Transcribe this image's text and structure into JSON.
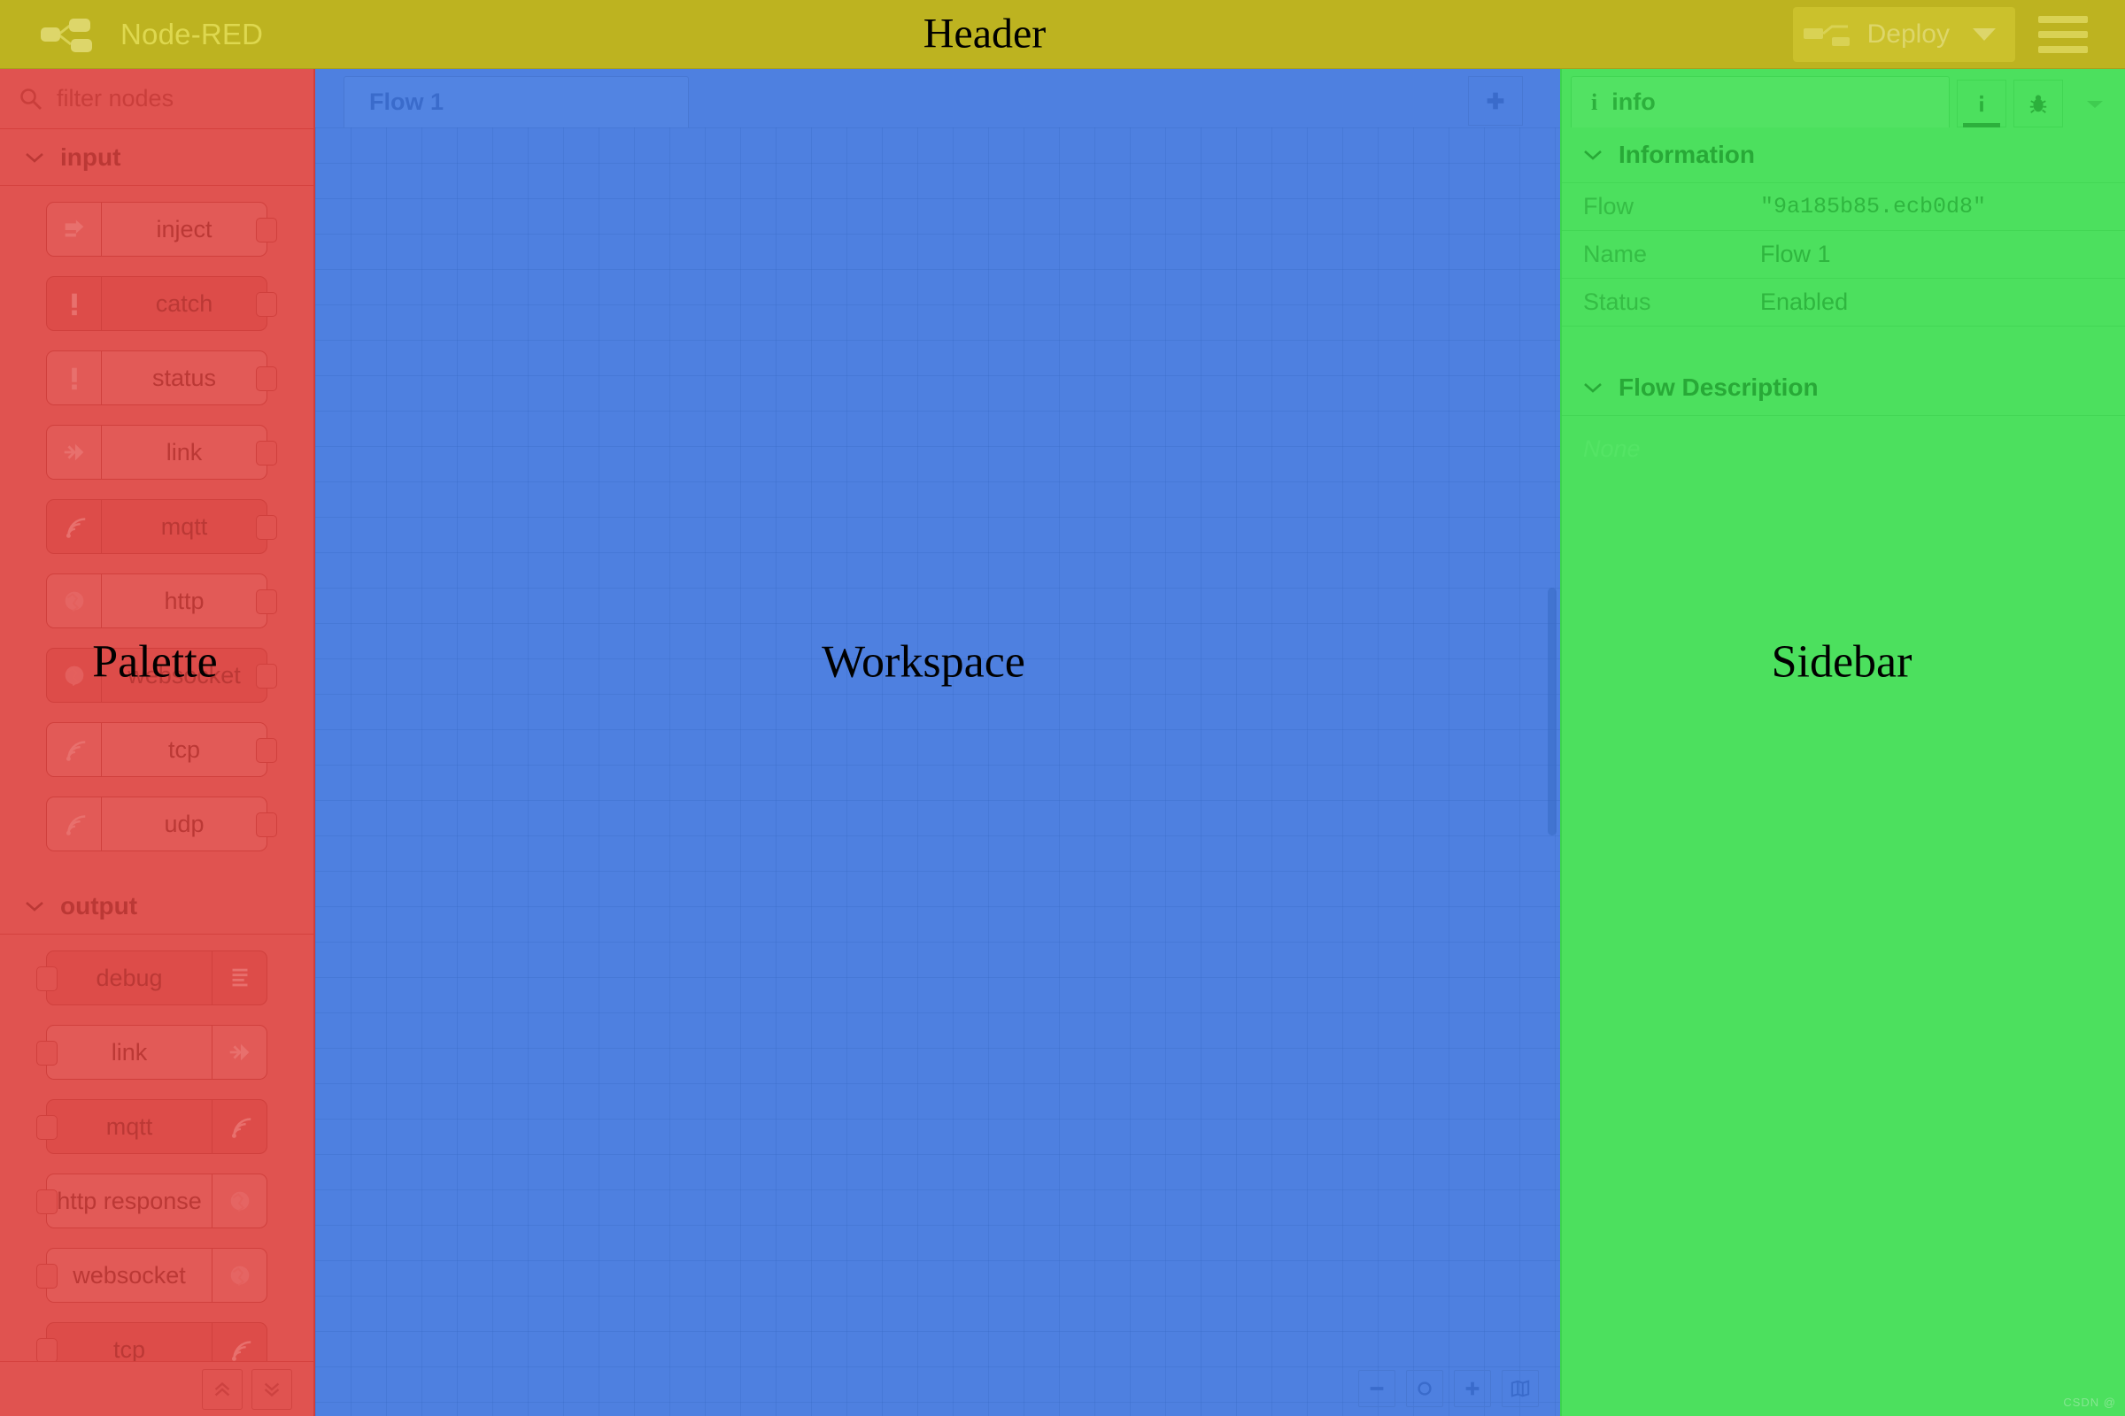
{
  "regions": {
    "header": "Header",
    "palette": "Palette",
    "workspace": "Workspace",
    "sidebar": "Sidebar"
  },
  "header": {
    "brand": "Node-RED",
    "deploy_label": "Deploy",
    "logo_icon": "node-red-logo-icon",
    "deploy_icon": "deploy-node-icon",
    "caret_icon": "chevron-down-icon",
    "menu_icon": "hamburger-menu-icon",
    "color": "#bdb320"
  },
  "palette": {
    "search_placeholder": "filter nodes",
    "search_value": "",
    "search_icon": "search-icon",
    "categories": [
      {
        "label": "input",
        "chevron": "chevron-down-icon",
        "nodes": [
          {
            "label": "inject",
            "icon": "inject-arrow-icon",
            "ports": "output"
          },
          {
            "label": "catch",
            "icon": "exclamation-icon",
            "ports": "output"
          },
          {
            "label": "status",
            "icon": "exclamation-icon",
            "ports": "output"
          },
          {
            "label": "link",
            "icon": "link-in-icon",
            "ports": "output"
          },
          {
            "label": "mqtt",
            "icon": "broadcast-icon",
            "ports": "output"
          },
          {
            "label": "http",
            "icon": "globe-icon",
            "ports": "output"
          },
          {
            "label": "websocket",
            "icon": "globe-icon",
            "ports": "output"
          },
          {
            "label": "tcp",
            "icon": "broadcast-icon",
            "ports": "output"
          },
          {
            "label": "udp",
            "icon": "broadcast-icon",
            "ports": "output"
          }
        ]
      },
      {
        "label": "output",
        "chevron": "chevron-down-icon",
        "nodes": [
          {
            "label": "debug",
            "icon": "debug-lines-icon",
            "ports": "input"
          },
          {
            "label": "link",
            "icon": "link-out-icon",
            "ports": "input"
          },
          {
            "label": "mqtt",
            "icon": "broadcast-icon",
            "ports": "input"
          },
          {
            "label": "http response",
            "icon": "globe-icon",
            "ports": "input"
          },
          {
            "label": "websocket",
            "icon": "globe-icon",
            "ports": "input"
          },
          {
            "label": "tcp",
            "icon": "broadcast-icon",
            "ports": "input"
          }
        ]
      }
    ],
    "footer": {
      "collapse_all_icon": "chevron-double-up-icon",
      "expand_all_icon": "chevron-double-down-icon"
    },
    "color": "#e05350"
  },
  "workspace": {
    "tabs": [
      {
        "label": "Flow 1",
        "active": true
      }
    ],
    "add_tab_icon": "plus-icon",
    "footer": {
      "zoom_out_icon": "minus-icon",
      "zoom_reset_icon": "circle-icon",
      "zoom_in_icon": "plus-icon",
      "navigator_icon": "map-icon"
    },
    "color": "#4e80e0"
  },
  "sidebar": {
    "tab": {
      "label": "info",
      "icon": "info-icon"
    },
    "buttons": [
      {
        "name": "info-tab-button",
        "icon": "info-icon",
        "active": true
      },
      {
        "name": "debug-tab-button",
        "icon": "bug-icon",
        "active": false
      },
      {
        "name": "sidebar-menu-button",
        "icon": "chevron-down-icon",
        "active": false
      }
    ],
    "information": {
      "title": "Information",
      "chevron": "chevron-down-icon",
      "rows": [
        {
          "key": "Flow",
          "value": "\"9a185b85.ecb0d8\"",
          "mono": true
        },
        {
          "key": "Name",
          "value": "Flow 1",
          "mono": false
        },
        {
          "key": "Status",
          "value": "Enabled",
          "mono": false
        }
      ]
    },
    "description": {
      "title": "Flow Description",
      "chevron": "chevron-down-icon",
      "body": "None"
    },
    "watermark": "CSDN @",
    "color": "#4ce05e"
  }
}
